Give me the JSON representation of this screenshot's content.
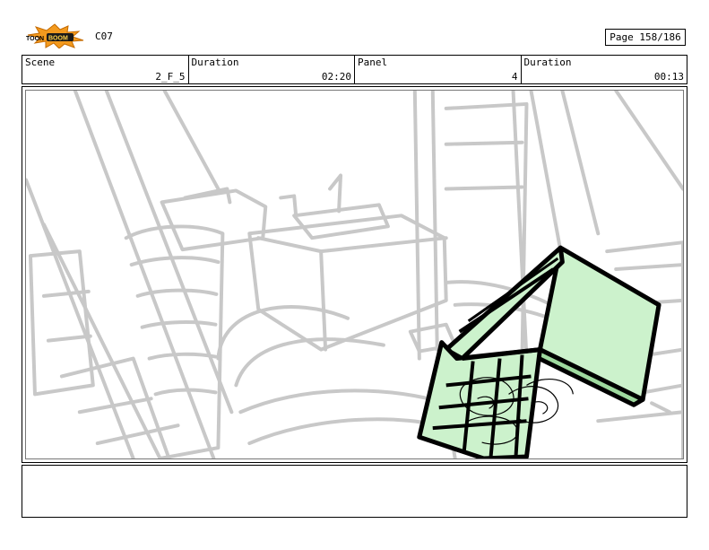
{
  "header": {
    "logo_text": "TOONBOOM",
    "code": "C07",
    "page": "Page 158/186"
  },
  "info": {
    "scene_label": "Scene",
    "scene_value": "2_F_5",
    "duration_label": "Duration",
    "duration_value": "02:20",
    "panel_label": "Panel",
    "panel_value": "4",
    "panel_duration_label": "Duration",
    "panel_duration_value": "00:13"
  },
  "colors": {
    "sketch_gray": "#c8c8c8",
    "highlight_green": "#ccf2cc",
    "logo_orange": "#f39a1e"
  },
  "notes": {
    "text": ""
  }
}
